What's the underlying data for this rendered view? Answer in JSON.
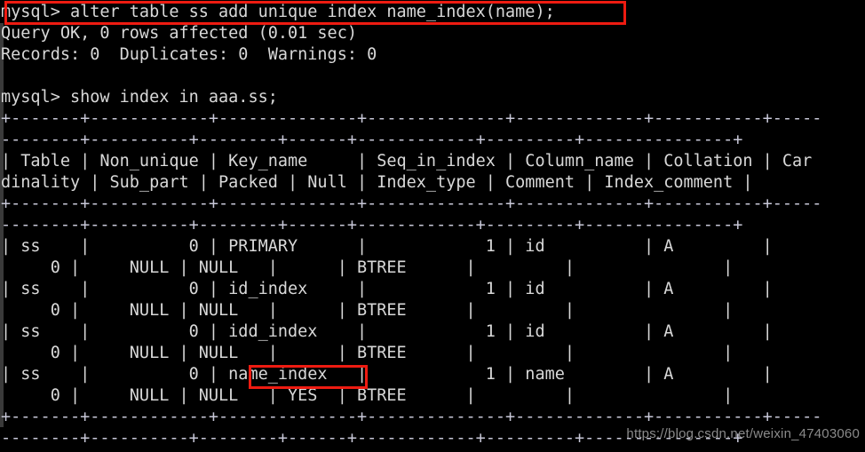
{
  "terminal": {
    "app": "mysql-client-terminal",
    "prompt": "mysql>",
    "background_color": "#000000",
    "foreground_color": "#d8d8d8",
    "rule_color": "#c8c8d8",
    "annotation_color": "#ee1b11",
    "lines": [
      "mysql> alter table ss add unique index name_index(name);",
      "Query OK, 0 rows affected (0.01 sec)",
      "Records: 0  Duplicates: 0  Warnings: 0",
      "",
      "mysql> show index in aaa.ss;",
      "+-------+------------+--------------+--------------+-------------+-----------+-----",
      "--------+----------+--------+------+------------+---------+---------------+",
      "| Table | Non_unique | Key_name     | Seq_in_index | Column_name | Collation | Car",
      "dinality | Sub_part | Packed | Null | Index_type | Comment | Index_comment |",
      "+-------+------------+--------------+--------------+-------------+-----------+-----",
      "--------+----------+--------+------+------------+---------+---------------+",
      "| ss    |          0 | PRIMARY      |            1 | id          | A         |     ",
      "     0 |     NULL | NULL   |      | BTREE      |         |               |",
      "| ss    |          0 | id_index     |            1 | id          | A         |     ",
      "     0 |     NULL | NULL   |      | BTREE      |         |               |",
      "| ss    |          0 | idd_index    |            1 | id          | A         |     ",
      "     0 |     NULL | NULL   |      | BTREE      |         |               |",
      "| ss    |          0 | name_index   |            1 | name        | A         |     ",
      "     0 |     NULL | NULL   | YES  | BTREE      |         |               |",
      "+-------+------------+--------------+--------------+-------------+-----------+-----",
      "--------+----------+--------+------+------------+---------+---------------+"
    ]
  },
  "commands": {
    "alter_table": "alter table ss add unique index name_index(name);",
    "show_index": "show index in aaa.ss;"
  },
  "query_result": {
    "status_line": "Query OK, 0 rows affected (0.01 sec)",
    "records_line": "Records: 0  Duplicates: 0  Warnings: 0",
    "records": "0",
    "duplicates": "0",
    "warnings": "0",
    "rows_affected": "0",
    "duration": "0.01 sec"
  },
  "index_table": {
    "columns": [
      "Table",
      "Non_unique",
      "Key_name",
      "Seq_in_index",
      "Column_name",
      "Collation",
      "Cardinality",
      "Sub_part",
      "Packed",
      "Null",
      "Index_type",
      "Comment",
      "Index_comment"
    ],
    "rows": [
      {
        "Table": "ss",
        "Non_unique": "0",
        "Key_name": "PRIMARY",
        "Seq_in_index": "1",
        "Column_name": "id",
        "Collation": "A",
        "Cardinality": "0",
        "Sub_part": "NULL",
        "Packed": "NULL",
        "Null": "",
        "Index_type": "BTREE",
        "Comment": "",
        "Index_comment": ""
      },
      {
        "Table": "ss",
        "Non_unique": "0",
        "Key_name": "id_index",
        "Seq_in_index": "1",
        "Column_name": "id",
        "Collation": "A",
        "Cardinality": "0",
        "Sub_part": "NULL",
        "Packed": "NULL",
        "Null": "",
        "Index_type": "BTREE",
        "Comment": "",
        "Index_comment": ""
      },
      {
        "Table": "ss",
        "Non_unique": "0",
        "Key_name": "idd_index",
        "Seq_in_index": "1",
        "Column_name": "id",
        "Collation": "A",
        "Cardinality": "0",
        "Sub_part": "NULL",
        "Packed": "NULL",
        "Null": "",
        "Index_type": "BTREE",
        "Comment": "",
        "Index_comment": ""
      },
      {
        "Table": "ss",
        "Non_unique": "0",
        "Key_name": "name_index",
        "Seq_in_index": "1",
        "Column_name": "name",
        "Collation": "A",
        "Cardinality": "0",
        "Sub_part": "NULL",
        "Packed": "NULL",
        "Null": "YES",
        "Index_type": "BTREE",
        "Comment": "",
        "Index_comment": ""
      }
    ]
  },
  "annotations": [
    {
      "id": "command-highlight",
      "target_text": "mysql> alter table ss add unique index name_index(name);",
      "color": "#ee1b11"
    },
    {
      "id": "name-index-highlight",
      "target_text": "name_index",
      "color": "#ee1b11"
    }
  ],
  "watermark": {
    "text": "https://blog.csdn.net/weixin_47403060"
  }
}
